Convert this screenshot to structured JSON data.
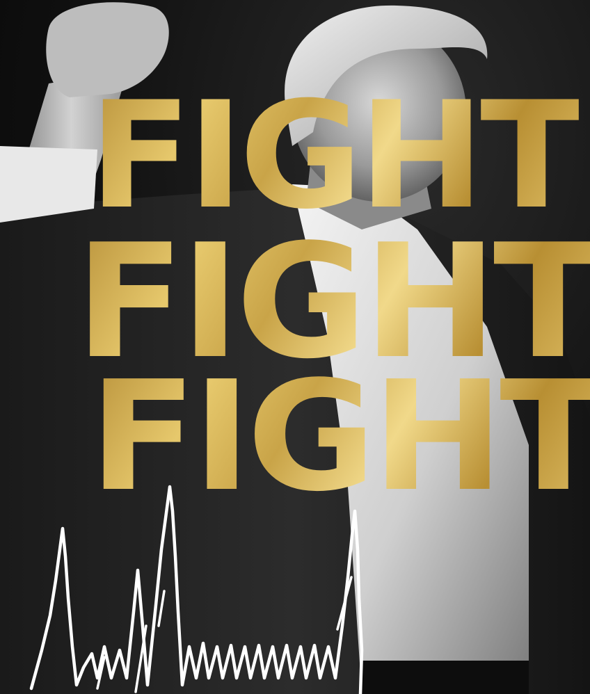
{
  "headline": {
    "line1": "FIGHT",
    "line2": "FIGHT",
    "line3": "FIGHT"
  },
  "colors": {
    "background": "#0b0b0b",
    "gold": "#d9b95a",
    "signature": "#ffffff"
  }
}
